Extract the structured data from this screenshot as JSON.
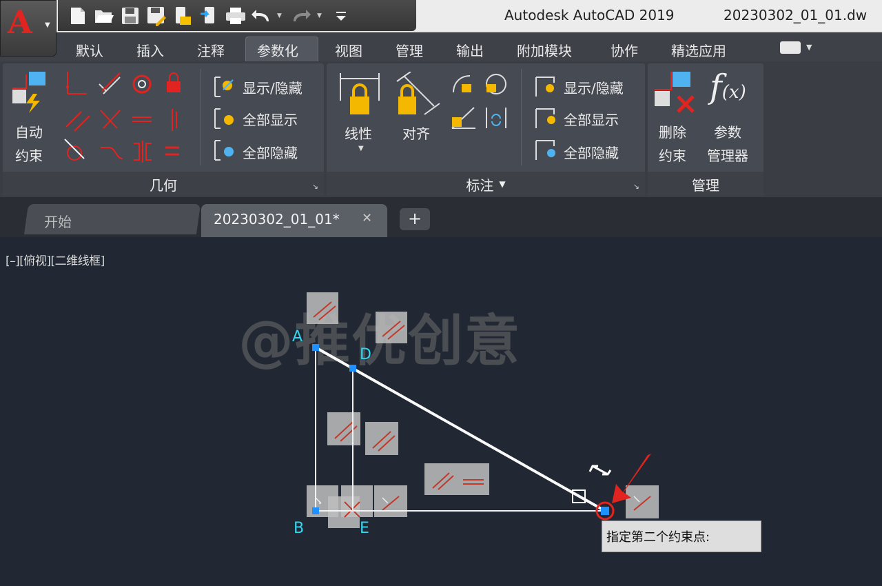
{
  "app": {
    "title": "Autodesk AutoCAD 2019",
    "document": "20230302_01_01.dw"
  },
  "colors": {
    "accent": "#e1241f",
    "point": "#1e90ff",
    "label": "#33d6f2",
    "lock": "#f5b800"
  },
  "quick_access": [
    "new-icon",
    "open-icon",
    "save-icon",
    "save-as-icon",
    "open-from-web-icon",
    "save-to-web-icon",
    "plot-icon",
    "undo-icon",
    "redo-icon",
    "customize-icon"
  ],
  "ribbon": {
    "tabs": [
      "默认",
      "插入",
      "注释",
      "参数化",
      "视图",
      "管理",
      "输出",
      "附加模块",
      "协作",
      "精选应用"
    ],
    "active_tab": "参数化",
    "geometry": {
      "title": "几何",
      "auto_constrain": [
        "自动",
        "约束"
      ],
      "show_hide": "显示/隐藏",
      "show_all": "全部显示",
      "hide_all": "全部隐藏"
    },
    "dimensional": {
      "title": "标注",
      "linear": "线性",
      "aligned": "对齐",
      "show_hide": "显示/隐藏",
      "show_all": "全部显示",
      "hide_all": "全部隐藏"
    },
    "manage": {
      "title": "管理",
      "delete": [
        "删除",
        "约束"
      ],
      "params": [
        "参数",
        "管理器"
      ]
    }
  },
  "doc_tabs": {
    "start": "开始",
    "active": "20230302_01_01*"
  },
  "viewport": {
    "label": "[–][俯视][二维线框]",
    "watermark": "@推优创意",
    "points": [
      "A",
      "B",
      "D",
      "E"
    ],
    "prompt": "指定第二个约束点:"
  }
}
